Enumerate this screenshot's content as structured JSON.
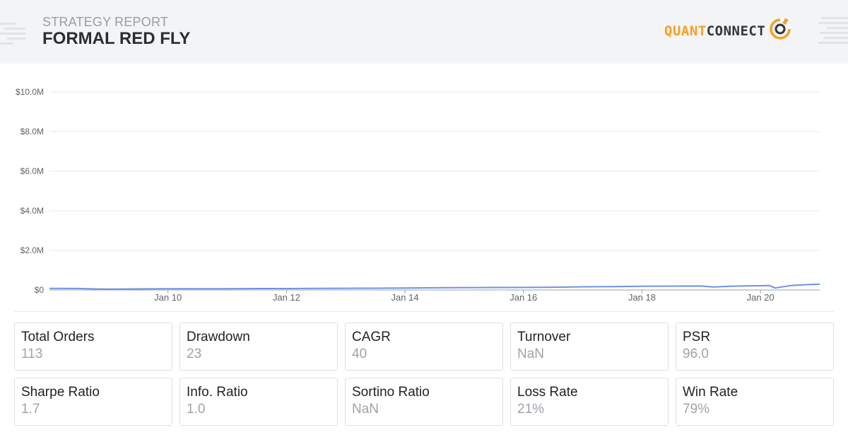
{
  "header": {
    "subtitle": "STRATEGY REPORT",
    "title": "FORMAL RED FLY",
    "logo": {
      "part1": "QUANT",
      "part2": "CONNECT",
      "icon": "quantconnect-logo-icon"
    }
  },
  "colors": {
    "accent": "#f5a024",
    "line": "#6d93e0",
    "grid": "#e9eaed",
    "header_bg": "#f3f4f6"
  },
  "chart_data": {
    "type": "line",
    "title": "",
    "xlabel": "",
    "ylabel": "",
    "ylim": [
      0,
      10000000
    ],
    "y_ticks": [
      "$0",
      "$2.0M",
      "$4.0M",
      "$6.0M",
      "$8.0M",
      "$10.0M"
    ],
    "x_tick_labels": [
      "Jan 10",
      "Jan 12",
      "Jan 14",
      "Jan 16",
      "Jan 18",
      "Jan 20"
    ],
    "x_tick_days": [
      10,
      12,
      14,
      16,
      18,
      20
    ],
    "xlim_days": [
      8.0,
      21.0
    ],
    "grid": true,
    "legend": "none",
    "series": [
      {
        "values_days": [
          8.0,
          8.5,
          8.8,
          9.0,
          9.5,
          10.0,
          10.5,
          11.0,
          11.5,
          12.0,
          12.5,
          13.0,
          13.5,
          14.0,
          14.5,
          15.0,
          15.5,
          16.0,
          16.5,
          17.0,
          17.5,
          18.0,
          18.5,
          19.0,
          19.2,
          19.5,
          19.8,
          20.0,
          20.15,
          20.25,
          20.5,
          20.8,
          21.0
        ],
        "values": [
          80000,
          75000,
          50000,
          45000,
          55000,
          60000,
          62000,
          65000,
          72000,
          70000,
          80000,
          85000,
          90000,
          100000,
          110000,
          120000,
          125000,
          130000,
          140000,
          160000,
          170000,
          185000,
          195000,
          200000,
          150000,
          190000,
          210000,
          215000,
          225000,
          100000,
          220000,
          270000,
          290000
        ]
      }
    ]
  },
  "stats": [
    {
      "label": "Total Orders",
      "value": "113"
    },
    {
      "label": "Drawdown",
      "value": "23"
    },
    {
      "label": "CAGR",
      "value": "40"
    },
    {
      "label": "Turnover",
      "value": "NaN"
    },
    {
      "label": "PSR",
      "value": "96.0"
    },
    {
      "label": "Sharpe Ratio",
      "value": "1.7"
    },
    {
      "label": "Info. Ratio",
      "value": "1.0"
    },
    {
      "label": "Sortino Ratio",
      "value": "NaN"
    },
    {
      "label": "Loss Rate",
      "value": "21%"
    },
    {
      "label": "Win Rate",
      "value": "79%"
    }
  ]
}
